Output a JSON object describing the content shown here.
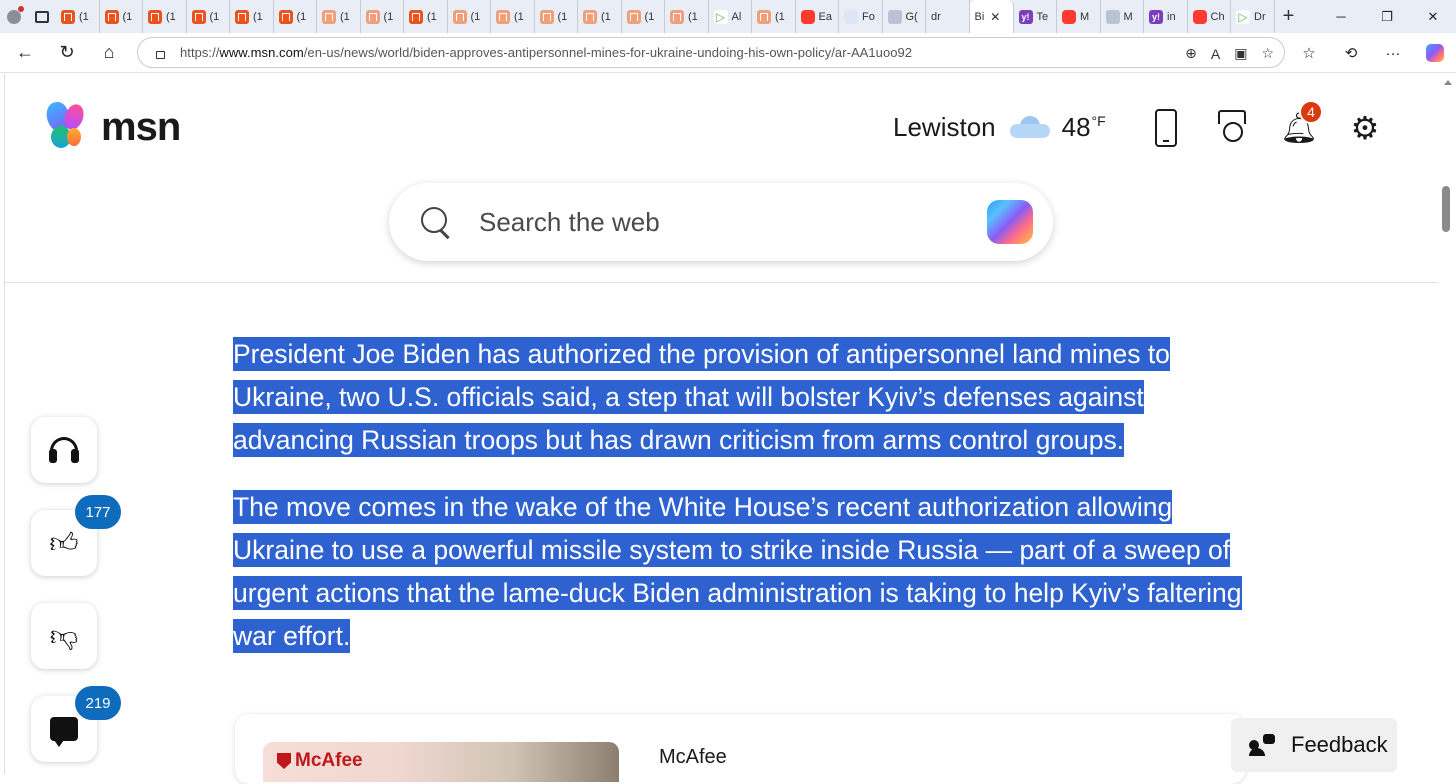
{
  "browser": {
    "tabs": [
      {
        "icon": "orange",
        "label": "(1"
      },
      {
        "icon": "orange",
        "label": "(1"
      },
      {
        "icon": "orange",
        "label": "(1"
      },
      {
        "icon": "orange",
        "label": "(1"
      },
      {
        "icon": "orange",
        "label": "(1"
      },
      {
        "icon": "orange",
        "label": "(1"
      },
      {
        "icon": "peach",
        "label": "(1"
      },
      {
        "icon": "peach",
        "label": "(1"
      },
      {
        "icon": "orange",
        "label": "(1"
      },
      {
        "icon": "peach",
        "label": "(1"
      },
      {
        "icon": "peach",
        "label": "(1"
      },
      {
        "icon": "peach",
        "label": "(1"
      },
      {
        "icon": "peach",
        "label": "(1"
      },
      {
        "icon": "peach",
        "label": "(1"
      },
      {
        "icon": "peach",
        "label": "(1"
      },
      {
        "icon": "green",
        "label": "Al"
      },
      {
        "icon": "peach",
        "label": "(1"
      },
      {
        "icon": "red",
        "label": "Ea"
      },
      {
        "icon": "blue",
        "label": "Fo"
      },
      {
        "icon": "grey",
        "label": "G("
      },
      {
        "icon": "search",
        "label": "dr"
      }
    ],
    "active_tab": {
      "label": "Bi",
      "close": "✕"
    },
    "tabs_after": [
      {
        "icon": "purple",
        "label": "Te"
      },
      {
        "icon": "red",
        "label": "M"
      },
      {
        "icon": "grey",
        "label": "M"
      },
      {
        "icon": "purple",
        "label": "in"
      },
      {
        "icon": "red",
        "label": "Ch"
      },
      {
        "icon": "green",
        "label": "Dr"
      }
    ],
    "url_prefix": "https://",
    "url_host": "www.msn.com",
    "url_path": "/en-us/news/world/biden-approves-antipersonnel-mines-for-ukraine-undoing-his-own-policy/ar-AA1uoo92"
  },
  "header": {
    "logo_text": "msn",
    "city": "Lewiston",
    "temperature": "48",
    "unit": "°F",
    "notification_count": "4"
  },
  "search": {
    "placeholder": "Search the web"
  },
  "article": {
    "paragraphs": [
      "President Joe Biden has authorized the provision of antipersonnel land mines to Ukraine, two U.S. officials said, a step that will bolster Kyiv’s defenses against advancing Russian troops but has drawn criticism from arms control groups.",
      "The move comes in the wake of the White House’s recent authorization allowing Ukraine to use a powerful missile system to strike inside Russia — part of a sweep of urgent actions that the lame-duck Biden administration is taking to help Kyiv’s faltering war effort."
    ]
  },
  "side_actions": {
    "like_count": "177",
    "comment_count": "219"
  },
  "ad": {
    "brand": "McAfee",
    "source": "McAfee"
  },
  "feedback": {
    "label": "Feedback"
  }
}
